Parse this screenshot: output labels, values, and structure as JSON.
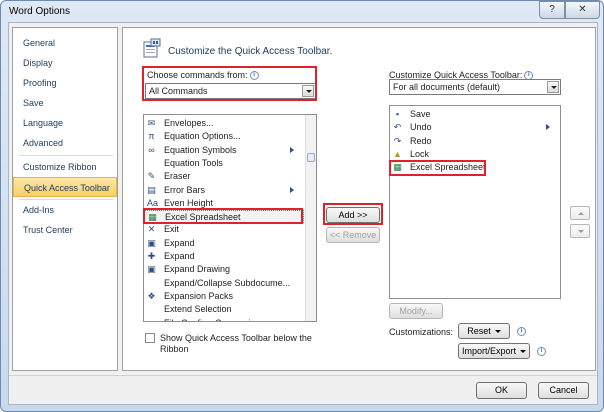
{
  "window": {
    "title": "Word Options",
    "help_glyph": "?",
    "close_glyph": "✕"
  },
  "nav": {
    "items": [
      {
        "label": "General"
      },
      {
        "label": "Display"
      },
      {
        "label": "Proofing"
      },
      {
        "label": "Save"
      },
      {
        "label": "Language"
      },
      {
        "label": "Advanced"
      },
      {
        "label": "Customize Ribbon"
      },
      {
        "label": "Quick Access Toolbar",
        "selected": true
      },
      {
        "label": "Add-Ins"
      },
      {
        "label": "Trust Center"
      }
    ]
  },
  "main": {
    "header": "Customize the Quick Access Toolbar.",
    "choose_label": "Choose commands from:",
    "choose_value": "All Commands",
    "customize_label": "Customize Quick Access Toolbar:",
    "customize_value": "For all documents (default)",
    "info_glyph": "i",
    "commands": [
      {
        "icon": "envelope-icon",
        "glyph": "✉",
        "label": "Envelopes..."
      },
      {
        "icon": "pi-icon",
        "glyph": "π",
        "label": "Equation Options..."
      },
      {
        "icon": "infinity-icon",
        "glyph": "∞",
        "label": "Equation Symbols",
        "submenu": true
      },
      {
        "icon": "none",
        "glyph": "",
        "label": "Equation Tools",
        "submenu": false
      },
      {
        "icon": "eraser-icon",
        "glyph": "✎",
        "label": "Eraser"
      },
      {
        "icon": "error-bars-icon",
        "glyph": "▤",
        "label": "Error Bars",
        "submenu": true
      },
      {
        "icon": "even-height-icon",
        "glyph": "Aa",
        "label": "Even Height"
      },
      {
        "icon": "excel-icon",
        "glyph": "▦",
        "label": "Excel Spreadsheet",
        "selected": true
      },
      {
        "icon": "exit-icon",
        "glyph": "✕",
        "label": "Exit"
      },
      {
        "icon": "expand-icon",
        "glyph": "▣",
        "label": "Expand"
      },
      {
        "icon": "expand-plus-icon",
        "glyph": "✚",
        "label": "Expand"
      },
      {
        "icon": "expand-drawing-icon",
        "glyph": "▣",
        "label": "Expand Drawing"
      },
      {
        "icon": "none",
        "glyph": "",
        "label": "Expand/Collapse Subdocume..."
      },
      {
        "icon": "expansion-packs-icon",
        "glyph": "❖",
        "label": "Expansion Packs"
      },
      {
        "icon": "none",
        "glyph": "",
        "label": "Extend Selection"
      },
      {
        "icon": "none",
        "glyph": "",
        "label": "File Confirm Conversions"
      }
    ],
    "qat_items": [
      {
        "icon": "save-icon",
        "glyph": "▪",
        "label": "Save"
      },
      {
        "icon": "undo-icon",
        "glyph": "↶",
        "label": "Undo",
        "submenu": true
      },
      {
        "icon": "redo-icon",
        "glyph": "↷",
        "label": "Redo"
      },
      {
        "icon": "lock-icon",
        "glyph": "▲",
        "label": "Lock"
      },
      {
        "icon": "excel-icon",
        "glyph": "▦",
        "label": "Excel Spreadsheet"
      }
    ],
    "add_label": "Add >>",
    "remove_label": "<< Remove",
    "modify_label": "Modify...",
    "customizations_label": "Customizations:",
    "reset_label": "Reset",
    "import_export_label": "Import/Export",
    "show_below_label_line1": "Show Quick Access Toolbar below the",
    "show_below_label_line2": "Ribbon",
    "show_below_checked": false
  },
  "footer": {
    "ok_label": "OK",
    "cancel_label": "Cancel"
  },
  "colors": {
    "highlight": "#e0202a",
    "selected_nav": "#f6d061",
    "title_text": "#1e395b"
  }
}
